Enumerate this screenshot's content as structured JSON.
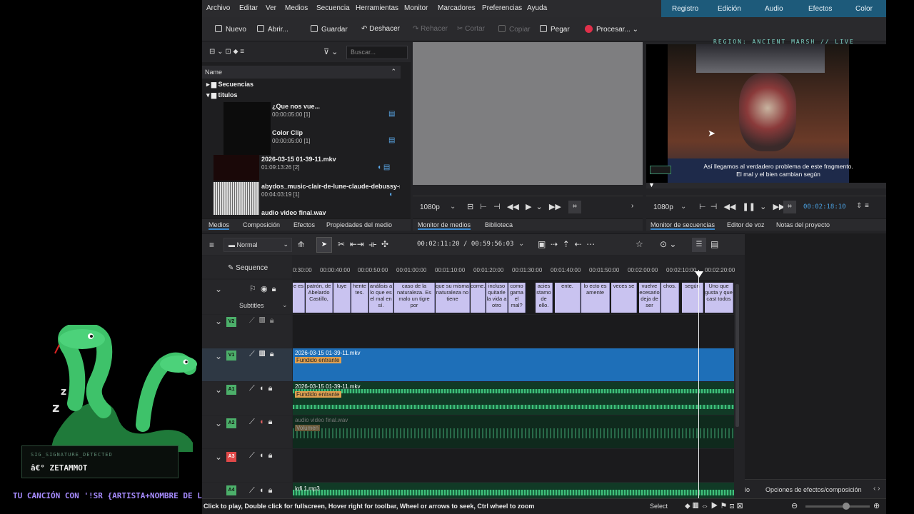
{
  "menu": [
    "Archivo",
    "Editar",
    "Ver",
    "Medios",
    "Secuencia",
    "Herramientas",
    "Monitor",
    "Marcadores",
    "Preferencias",
    "Ayuda"
  ],
  "workspace_tabs": [
    "Registro",
    "Edición",
    "Audio",
    "Efectos",
    "Color"
  ],
  "region_label": "REGION: ANCIENT_MARSH // LIVE",
  "toolbar": {
    "nuevo": "Nuevo",
    "abrir": "Abrir...",
    "guardar": "Guardar",
    "deshacer": "Deshacer",
    "rehacer": "Rehacer",
    "cortar": "Cortar",
    "copiar": "Copiar",
    "pegar": "Pegar",
    "procesar": "Procesar..."
  },
  "bin": {
    "search_placeholder": "Buscar...",
    "column_name": "Name",
    "folders": [
      "Secuencias",
      "titulos"
    ],
    "items": [
      {
        "title": "¿Que nos vue...",
        "sub": "00:00:05:00 [1]"
      },
      {
        "title": "Color Clip",
        "sub": "00:00:05:00 [1]"
      },
      {
        "title": "2026-03-15 01-39-11.mkv",
        "sub": "01:09:13:26 [2]"
      },
      {
        "title": "abydos_music-clair-de-lune-claude-debussy-me",
        "sub": "00:04:03:19 [1]"
      },
      {
        "title": "audio video final.wav",
        "sub": ""
      }
    ],
    "tabs": [
      "Medios",
      "Composición",
      "Efectos",
      "Propiedades del medio"
    ]
  },
  "clip_monitor": {
    "resolution": "1080p",
    "tabs": [
      "Monitor de medios",
      "Biblioteca"
    ]
  },
  "seq_monitor": {
    "resolution": "1080p",
    "timecode": "00:02:18:10",
    "subtitle": "Así llegamos al verdadero problema de este fragmento. El mal y el bien cambian según",
    "tabs": [
      "Monitor de secuencias",
      "Editor de voz",
      "Notas del proyecto"
    ]
  },
  "timeline": {
    "mode": "Normal",
    "timecode": "00:02:11:20 / 00:59:56:03",
    "sequence_label": "Sequence",
    "subtitles_label": "Subtitles",
    "ruler": [
      "0:30:00",
      "00:00:40:00",
      "00:00:50:00",
      "00:01:00:00",
      "00:01:10:00",
      "00:01:20:00",
      "00:01:30:00",
      "00:01:40:00",
      "00:01:50:00",
      "00:02:00:00",
      "00:02:10:00",
      "00:02:20:00"
    ],
    "subtitle_cells": [
      "e es",
      "patrón, de Abelardo Castillo,",
      "luye",
      "hente tes.",
      "análisis a lo que es el mal en sí.",
      "caso de la naturaleza. Es malo un tigre por",
      "que su misma naturaleza no tiene",
      "come.",
      "incluso quitarle la vida a otro",
      "como gama el mal?",
      "",
      "acies stamo de ello.",
      "ente.",
      "lo ecto es amente",
      "veces se",
      "vuelve ecesario deja de ser",
      "chos.",
      "según",
      "Uno que gusta y que cast todos"
    ],
    "tracks": [
      {
        "id": "V2",
        "color": "#4caf6a"
      },
      {
        "id": "V1",
        "color": "#4caf6a",
        "clip": "2026-03-15 01-39-11.mkv",
        "fx": "Fundido entrante"
      },
      {
        "id": "A1",
        "color": "#4caf6a",
        "clip": "2026-03-15 01-39-11.mkv",
        "fx": "Fundido entrante"
      },
      {
        "id": "A2",
        "color": "#4caf6a",
        "clip": "audio video final.wav",
        "fx": "Volumen"
      },
      {
        "id": "A3",
        "color": "#e04848"
      },
      {
        "id": "A4",
        "color": "#4caf6a",
        "clip": "lofi 1.mp3"
      }
    ],
    "right_tabs": [
      "io",
      "Opciones de efectos/composición"
    ]
  },
  "status": {
    "hint": "Click to play, Double click for fullscreen, Hover right for toolbar, Wheel or arrows to seek, Ctrl wheel to zoom",
    "select": "Select"
  },
  "overlay": {
    "sig_title": "SIG_SIGNATURE_DETECTED",
    "sig_user": "â€° ZETAMMOT",
    "banner": "TU CANCIÓN CON '!SR {ARTISTA+NOMBRE DE LA CANCIÓN}'"
  }
}
